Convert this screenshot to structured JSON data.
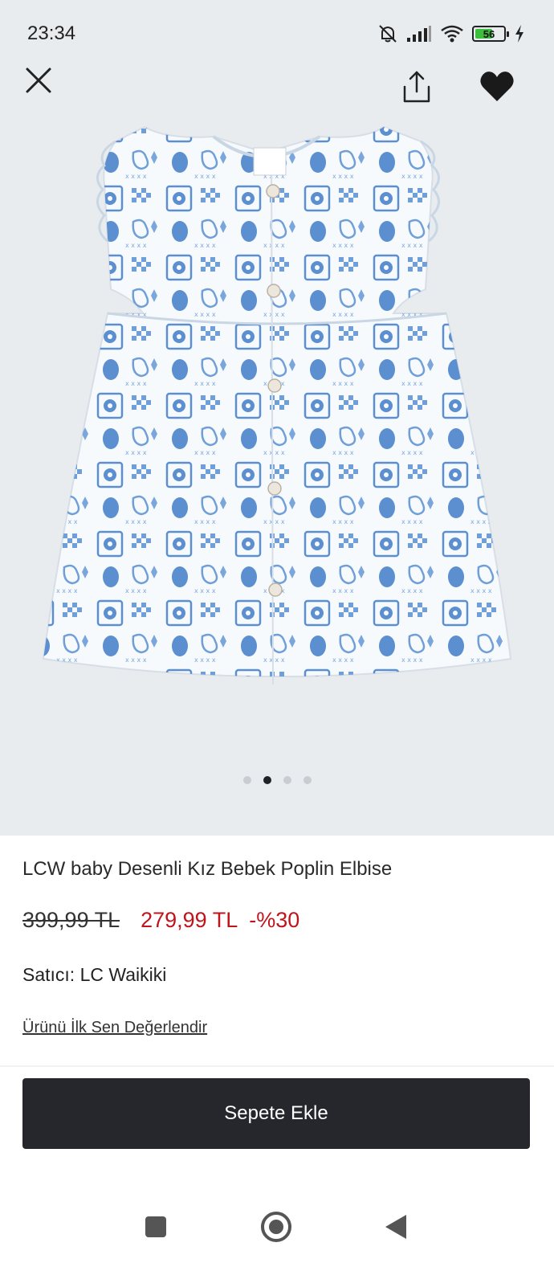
{
  "status_bar": {
    "time": "23:34",
    "battery_level": "56",
    "icons": [
      "mute-bell-icon",
      "signal-icon",
      "wifi-icon",
      "battery-icon",
      "charging-icon"
    ]
  },
  "top_actions": {
    "icons": [
      "close-icon",
      "share-icon",
      "heart-icon"
    ],
    "favorite_color": "#1a1a1a"
  },
  "gallery": {
    "image_count": 4,
    "active_index": 1,
    "dot_colors": {
      "active": "#1f2227",
      "inactive": "#c9ccd0"
    }
  },
  "product": {
    "title": "LCW baby Desenli Kız Bebek Poplin Elbise",
    "old_price": "399,99 TL",
    "new_price": "279,99 TL",
    "discount": "-%30",
    "seller_label": "Satıcı:",
    "seller_name": "LC Waikiki",
    "review_link": "Ürünü İlk Sen Değerlendir",
    "price_color": "#c0141d"
  },
  "cart": {
    "button_label": "Sepete Ekle",
    "button_color": "#25272c"
  },
  "nav_bar": {
    "icons": [
      "recent-apps-icon",
      "home-icon",
      "back-icon"
    ]
  }
}
